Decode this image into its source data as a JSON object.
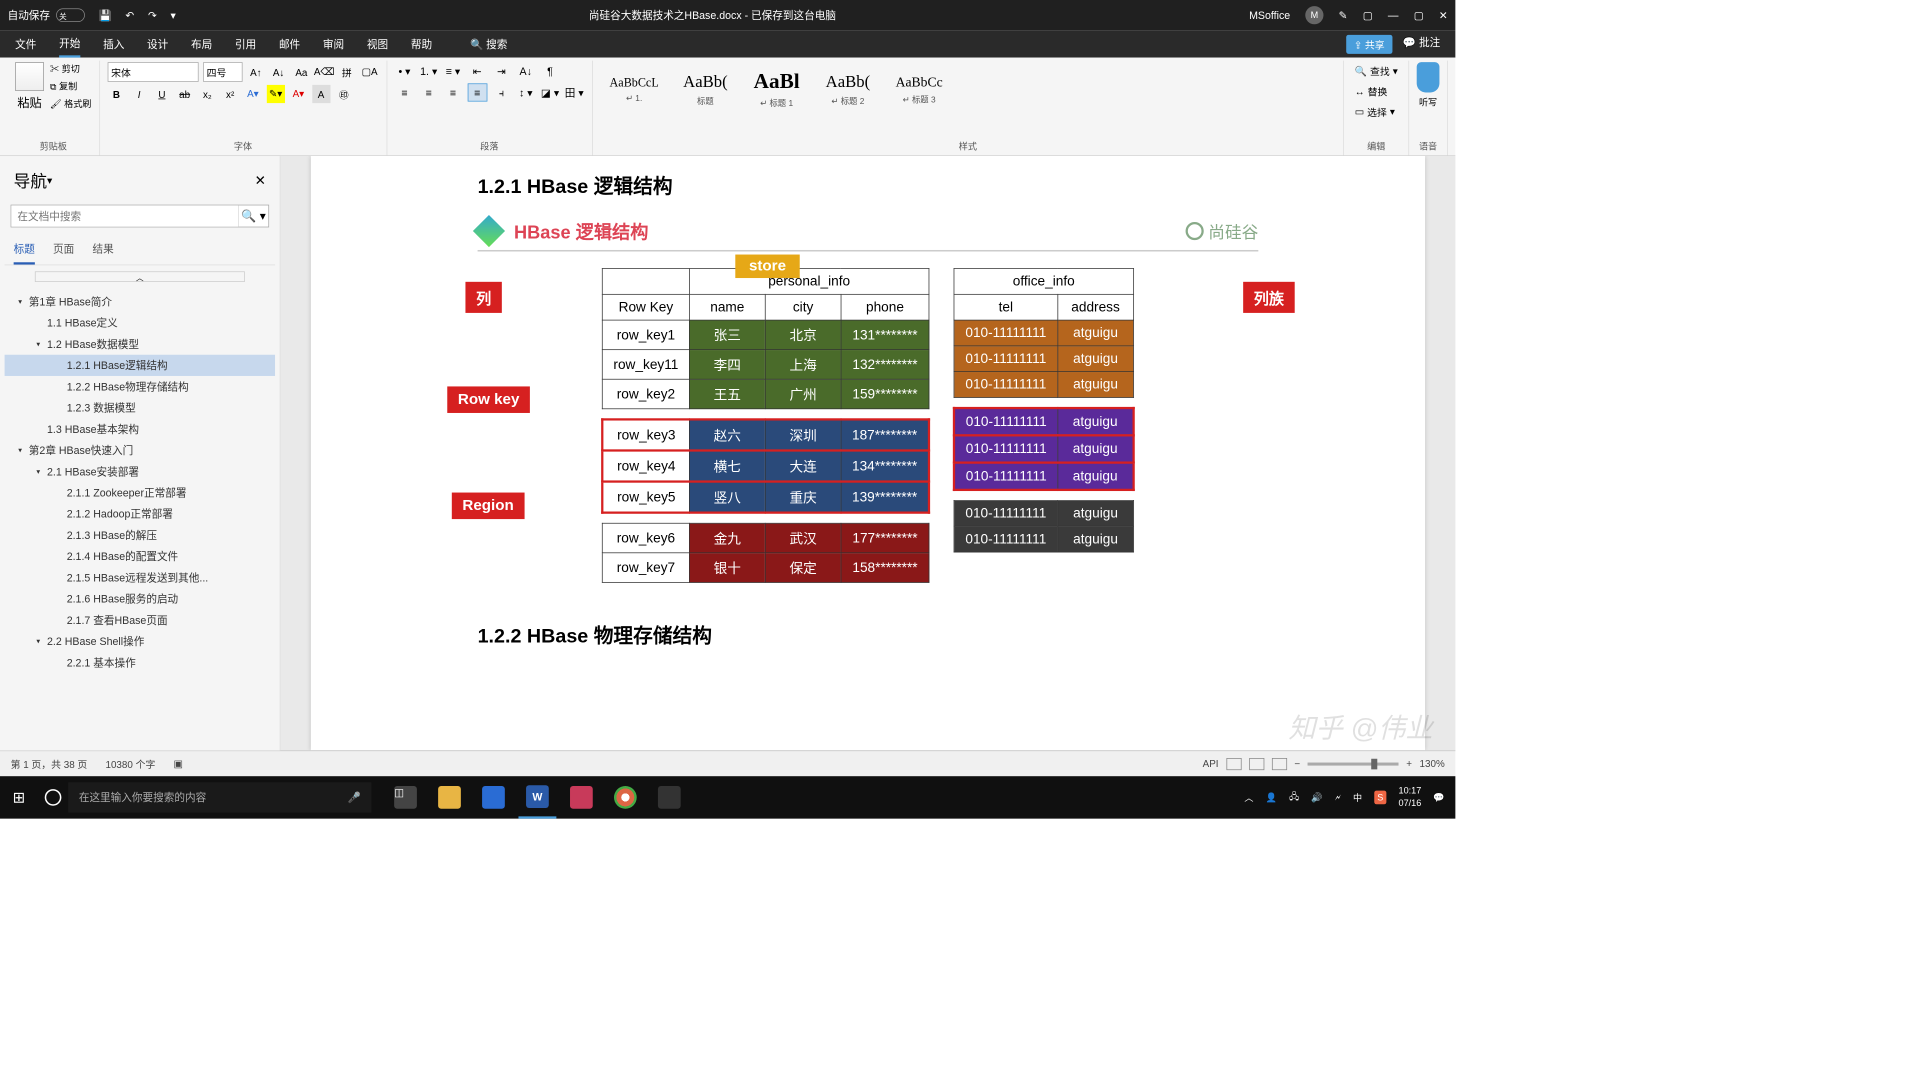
{
  "titlebar": {
    "autosave_label": "自动保存",
    "autosave_state": "关",
    "doc_title": "尚硅谷大数据技术之HBase.docx - 已保存到这台电脑",
    "user_label": "MSoffice",
    "user_initial": "M"
  },
  "ribbon_tabs": {
    "file": "文件",
    "home": "开始",
    "insert": "插入",
    "design": "设计",
    "layout": "布局",
    "refs": "引用",
    "mail": "邮件",
    "review": "审阅",
    "view": "视图",
    "help": "帮助",
    "search": "搜索",
    "share": "共享",
    "comments": "批注"
  },
  "ribbon": {
    "clipboard": {
      "paste": "粘贴",
      "cut": "剪切",
      "copy": "复制",
      "format_painter": "格式刷",
      "group": "剪贴板"
    },
    "font": {
      "name": "宋体",
      "size": "四号",
      "group": "字体"
    },
    "para": {
      "group": "段落"
    },
    "styles": {
      "group": "样式",
      "items": [
        {
          "preview": "AaBbCcL",
          "label": "↵ 1.",
          "size": "16px"
        },
        {
          "preview": "AaBb(",
          "label": "标题",
          "size": "22px"
        },
        {
          "preview": "AaBl",
          "label": "↵ 标题 1",
          "size": "28px",
          "bold": true
        },
        {
          "preview": "AaBb(",
          "label": "↵ 标题 2",
          "size": "22px"
        },
        {
          "preview": "AaBbCc",
          "label": "↵ 标题 3",
          "size": "18px"
        }
      ]
    },
    "editing": {
      "find": "查找",
      "replace": "替换",
      "select": "选择",
      "group": "编辑"
    },
    "voice": {
      "dictate": "听写",
      "group": "语音"
    }
  },
  "nav": {
    "title": "导航",
    "search_ph": "在文档中搜索",
    "tabs": {
      "headings": "标题",
      "pages": "页面",
      "results": "结果"
    },
    "tree": [
      {
        "text": "第1章 HBase简介",
        "level": 0,
        "caret": "▾"
      },
      {
        "text": "1.1 HBase定义",
        "level": 1
      },
      {
        "text": "1.2 HBase数据模型",
        "level": 1,
        "caret": "▾"
      },
      {
        "text": "1.2.1 HBase逻辑结构",
        "level": 2,
        "selected": true
      },
      {
        "text": "1.2.2 HBase物理存储结构",
        "level": 2
      },
      {
        "text": "1.2.3 数据模型",
        "level": 2
      },
      {
        "text": "1.3 HBase基本架构",
        "level": 1
      },
      {
        "text": "第2章 HBase快速入门",
        "level": 0,
        "caret": "▾"
      },
      {
        "text": "2.1 HBase安装部署",
        "level": 1,
        "caret": "▾"
      },
      {
        "text": "2.1.1 Zookeeper正常部署",
        "level": 2
      },
      {
        "text": "2.1.2 Hadoop正常部署",
        "level": 2
      },
      {
        "text": "2.1.3 HBase的解压",
        "level": 2
      },
      {
        "text": "2.1.4 HBase的配置文件",
        "level": 2
      },
      {
        "text": "2.1.5 HBase远程发送到其他...",
        "level": 2
      },
      {
        "text": "2.1.6 HBase服务的启动",
        "level": 2
      },
      {
        "text": "2.1.7 查看HBase页面",
        "level": 2
      },
      {
        "text": "2.2 HBase Shell操作",
        "level": 1,
        "caret": "▾"
      },
      {
        "text": "2.2.1 基本操作",
        "level": 2
      }
    ]
  },
  "doc": {
    "heading1": "1.2.1 HBase 逻辑结构",
    "heading2": "1.2.2 HBase 物理存储结构",
    "diag_title": "HBase 逻辑结构",
    "brand": "尚硅谷",
    "labels": {
      "col": "列",
      "rowkey": "Row key",
      "region": "Region",
      "colfam": "列族",
      "store": "store"
    },
    "left": {
      "header_span": "personal_info",
      "cols": [
        "Row Key",
        "name",
        "city",
        "phone"
      ],
      "rows": [
        {
          "k": "row_key1",
          "v": [
            "张三",
            "北京",
            "131********"
          ],
          "c": "green"
        },
        {
          "k": "row_key11",
          "v": [
            "李四",
            "上海",
            "132********"
          ],
          "c": "green"
        },
        {
          "k": "row_key2",
          "v": [
            "王五",
            "广州",
            "159********"
          ],
          "c": "green"
        },
        {
          "k": "row_key3",
          "v": [
            "赵六",
            "深圳",
            "187********"
          ],
          "c": "blue"
        },
        {
          "k": "row_key4",
          "v": [
            "横七",
            "大连",
            "134********"
          ],
          "c": "blue"
        },
        {
          "k": "row_key5",
          "v": [
            "竖八",
            "重庆",
            "139********"
          ],
          "c": "blue"
        },
        {
          "k": "row_key6",
          "v": [
            "金九",
            "武汉",
            "177********"
          ],
          "c": "red"
        },
        {
          "k": "row_key7",
          "v": [
            "银十",
            "保定",
            "158********"
          ],
          "c": "red"
        }
      ]
    },
    "right": {
      "header_span": "office_info",
      "cols": [
        "tel",
        "address"
      ],
      "rows": [
        {
          "v": [
            "010-11111111",
            "atguigu"
          ],
          "c": "orange"
        },
        {
          "v": [
            "010-11111111",
            "atguigu"
          ],
          "c": "orange"
        },
        {
          "v": [
            "010-11111111",
            "atguigu"
          ],
          "c": "orange"
        },
        {
          "v": [
            "010-11111111",
            "atguigu"
          ],
          "c": "purple"
        },
        {
          "v": [
            "010-11111111",
            "atguigu"
          ],
          "c": "purple"
        },
        {
          "v": [
            "010-11111111",
            "atguigu"
          ],
          "c": "purple"
        },
        {
          "v": [
            "010-11111111",
            "atguigu"
          ],
          "c": "dark"
        },
        {
          "v": [
            "010-11111111",
            "atguigu"
          ],
          "c": "dark"
        }
      ]
    }
  },
  "status": {
    "page": "第 1 页，共 38 页",
    "words": "10380 个字",
    "api": "API",
    "zoom": "130%"
  },
  "taskbar": {
    "search_ph": "在这里输入你要搜索的内容",
    "time": "10:17",
    "date": "07/16",
    "ime": "中"
  },
  "watermark": "知乎 @伟业"
}
